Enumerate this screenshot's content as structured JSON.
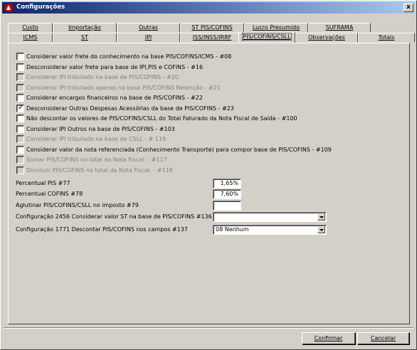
{
  "window": {
    "title": "Configurações",
    "close_label": "x"
  },
  "tabs_row1": [
    {
      "label": "Custo"
    },
    {
      "label": "Importação"
    },
    {
      "label": "Outras"
    },
    {
      "label": "ST PIS/COFINS"
    },
    {
      "label": "Lucro Presumido"
    },
    {
      "label": "SUFRAMA"
    }
  ],
  "tabs_row2": [
    {
      "label": "ICMS"
    },
    {
      "label": "ST"
    },
    {
      "label": "IPI"
    },
    {
      "label": "ISS/INSS/IRRF"
    },
    {
      "label": "PIS/COFINS/CSLL"
    },
    {
      "label": "Observações"
    },
    {
      "label": "Totais"
    }
  ],
  "checkboxes": [
    {
      "label": "Considerar valor frete do conhecimento na base PIS/COFINS/ICMS - #08",
      "checked": false,
      "disabled": false
    },
    {
      "label": "Desconsiderar valor frete para base de IPI,PIS e COFINS - #16",
      "checked": false,
      "disabled": false
    },
    {
      "label": "Considerar IPI tributado na base de PIS/COFINS - #20",
      "checked": false,
      "disabled": true
    },
    {
      "label": "Considerar IPI tributado apenas na base PIS/COFINS Retenção - #21",
      "checked": false,
      "disabled": true
    },
    {
      "label": "Considerar encargos financeiros na base de PIS/COFINS - #22",
      "checked": false,
      "disabled": false
    },
    {
      "label": "Desconsiderar Outras Despesas Acessórias da base de PIS/COFINS - #23",
      "checked": true,
      "disabled": false
    },
    {
      "label": "Não descontar os valores de PIS/COFINS/CSLL do Total Faturado da Nota Fiscal de Saída - #100",
      "checked": false,
      "disabled": false
    },
    {
      "label": "Considerar IPI Outros na base de PIS/COFINS - #103",
      "checked": false,
      "disabled": false
    },
    {
      "label": "Considerar IPI tributado na base de CSLL - # 119",
      "checked": false,
      "disabled": true
    },
    {
      "label": "Considerar valor da nota referenciada (Conhecimento Transporte) para compor base de PIS/COFINS - #109",
      "checked": false,
      "disabled": false
    },
    {
      "label": "Somar PIS/COFINS no total da Nota Fiscal. - #117",
      "checked": false,
      "disabled": true
    },
    {
      "label": "Diminuir PIS/COFINS no total da Nota Fiscal. - #118",
      "checked": false,
      "disabled": true
    }
  ],
  "fields": {
    "pis_label": "Percentual PIS #77",
    "pis_value": "1,65%",
    "cofins_label": "Percentual COFINS #78",
    "cofins_value": "7,60%",
    "aglutinar_label": "Aglutinar PIS/COFINS/CSLL no imposto #79",
    "aglutinar_value": "",
    "config2456_label": "Configuração 2456 Considerar valor ST na base de PIS/COFINS #136",
    "config2456_value": "",
    "config1771_label": "Configuração 1771 Descontar PIS/COFINS nos campos #137",
    "config1771_value": "08 Nenhum"
  },
  "buttons": {
    "confirm": "Confirmar",
    "cancel": "Cancelar"
  },
  "colors": {
    "titlebar_start": "#0a246a",
    "titlebar_end": "#a6caf0",
    "face": "#d4d0c8"
  }
}
